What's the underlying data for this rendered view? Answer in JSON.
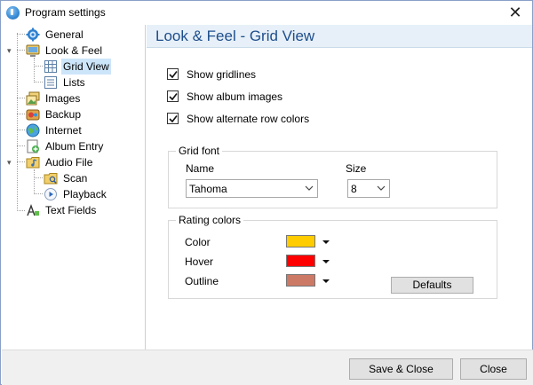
{
  "window": {
    "title": "Program settings"
  },
  "tree": {
    "items": [
      {
        "label": "General",
        "icon": "gear-icon"
      },
      {
        "label": "Look & Feel",
        "icon": "monitor-icon",
        "expanded": true
      },
      {
        "label": "Grid View",
        "icon": "grid-icon",
        "selected": true
      },
      {
        "label": "Lists",
        "icon": "list-icon"
      },
      {
        "label": "Images",
        "icon": "images-icon"
      },
      {
        "label": "Backup",
        "icon": "backup-icon"
      },
      {
        "label": "Internet",
        "icon": "globe-icon"
      },
      {
        "label": "Album Entry",
        "icon": "album-entry-icon"
      },
      {
        "label": "Audio File",
        "icon": "audio-folder-icon",
        "expanded": true
      },
      {
        "label": "Scan",
        "icon": "scan-folder-icon"
      },
      {
        "label": "Playback",
        "icon": "play-icon"
      },
      {
        "label": "Text Fields",
        "icon": "text-fields-icon"
      }
    ]
  },
  "content": {
    "title": "Look & Feel - Grid View",
    "checkboxes": [
      {
        "label": "Show gridlines",
        "checked": true
      },
      {
        "label": "Show album images",
        "checked": true
      },
      {
        "label": "Show alternate row colors",
        "checked": true
      }
    ],
    "grid_font": {
      "legend": "Grid font",
      "name_label": "Name",
      "name_value": "Tahoma",
      "size_label": "Size",
      "size_value": "8"
    },
    "rating_colors": {
      "legend": "Rating colors",
      "rows": [
        {
          "label": "Color",
          "color": "#ffcc00"
        },
        {
          "label": "Hover",
          "color": "#ff0000"
        },
        {
          "label": "Outline",
          "color": "#cc7a66"
        }
      ],
      "defaults_label": "Defaults"
    }
  },
  "footer": {
    "save_close_label": "Save & Close",
    "close_label": "Close"
  }
}
